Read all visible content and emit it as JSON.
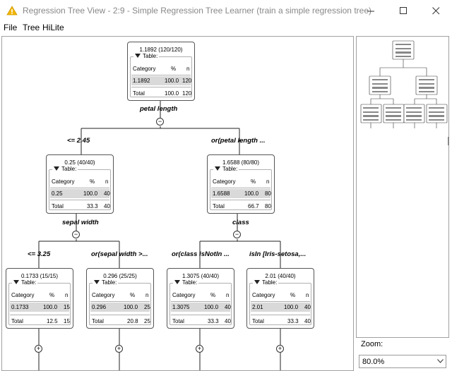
{
  "window": {
    "title": "Regression Tree View - 2:9 - Simple Regression Tree Learner (train a simple regression tree)",
    "icon": "warning-triangle-icon",
    "controls": [
      "minimize",
      "maximize",
      "close"
    ]
  },
  "menu": {
    "items": [
      "File",
      "Tree",
      "HiLite"
    ]
  },
  "table": {
    "label": "Table:",
    "col_category": "Category",
    "col_pct": "%",
    "col_n": "n",
    "total_label": "Total"
  },
  "nodes": {
    "root": {
      "title": "1.1892 (120/120)",
      "category": "1.1892",
      "pct": "100.0",
      "n": "120",
      "total_pct": "100.0",
      "total_n": "120"
    },
    "left": {
      "title": "0.25 (40/40)",
      "category": "0.25",
      "pct": "100.0",
      "n": "40",
      "total_pct": "33.3",
      "total_n": "40"
    },
    "right": {
      "title": "1.6588 (80/80)",
      "category": "1.6588",
      "pct": "100.0",
      "n": "80",
      "total_pct": "66.7",
      "total_n": "80"
    },
    "ll": {
      "title": "0.1733 (15/15)",
      "category": "0.1733",
      "pct": "100.0",
      "n": "15",
      "total_pct": "12.5",
      "total_n": "15"
    },
    "lr": {
      "title": "0.296 (25/25)",
      "category": "0.296",
      "pct": "100.0",
      "n": "25",
      "total_pct": "20.8",
      "total_n": "25"
    },
    "rl": {
      "title": "1.3075 (40/40)",
      "category": "1.3075",
      "pct": "100.0",
      "n": "40",
      "total_pct": "33.3",
      "total_n": "40"
    },
    "rr": {
      "title": "2.01 (40/40)",
      "category": "2.01",
      "pct": "100.0",
      "n": "40",
      "total_pct": "33.3",
      "total_n": "40"
    }
  },
  "splits": {
    "root": "petal length",
    "left": "sepal width",
    "right": "class"
  },
  "conditions": {
    "left": "<= 2.45",
    "right": "or(petal length ...",
    "ll": "<= 3.25",
    "lr": "or(sepal width >...",
    "rl": "or(class isNotIn ...",
    "rr": "isIn [Iris-setosa,..."
  },
  "toggles": {
    "collapse": "−",
    "expand": "+"
  },
  "zoom": {
    "label": "Zoom:",
    "value": "80.0%"
  }
}
